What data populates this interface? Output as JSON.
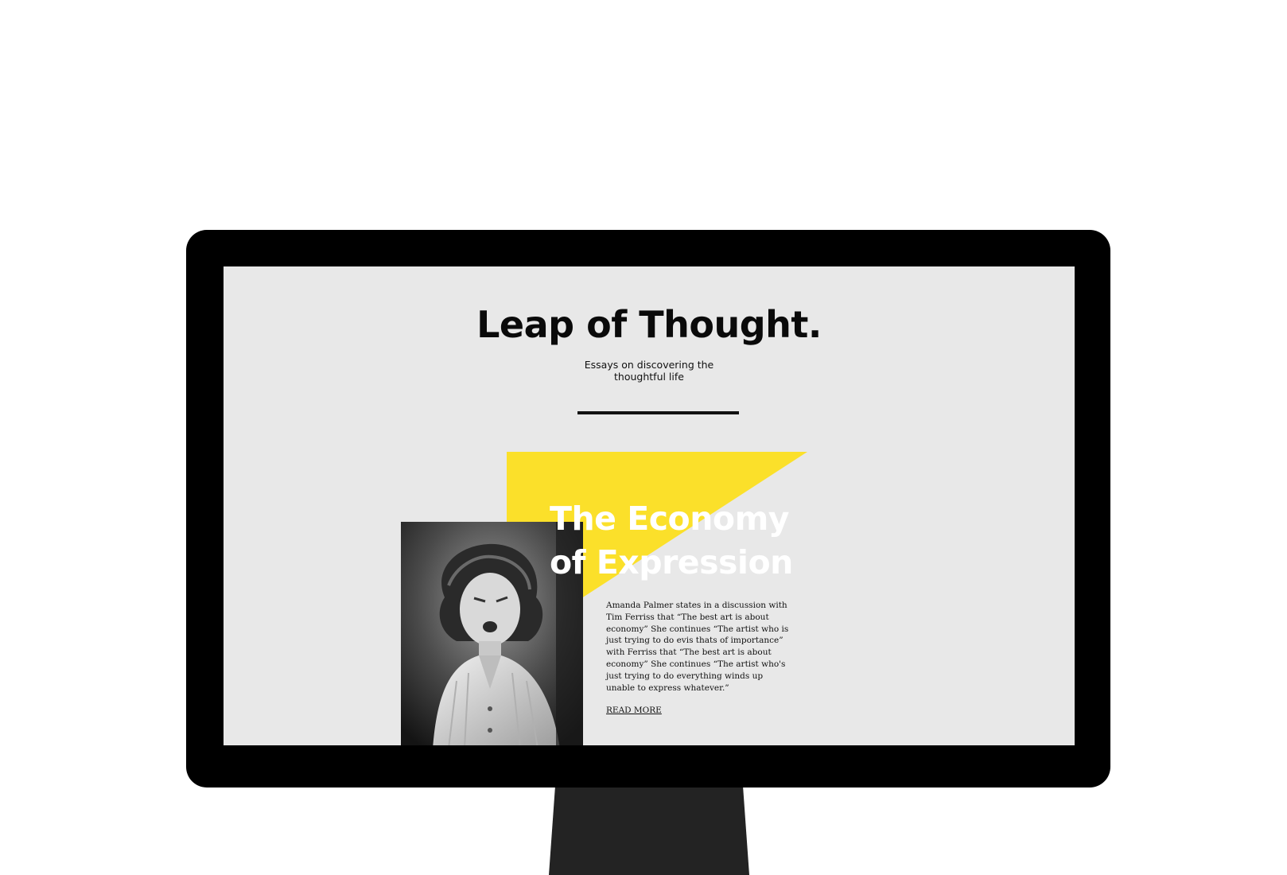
{
  "site": {
    "title": "Leap of Thought.",
    "tagline_lines": [
      "Essays on discovering the",
      "thoughtful life"
    ]
  },
  "feature": {
    "title_lines": [
      "The Economy",
      "of Expression"
    ],
    "excerpt_lines": [
      "Amanda Palmer states in a discussion with",
      "Tim Ferriss that “The best art is about",
      "economy” She continues “The artist who is",
      "just trying to do evis thats of importance”",
      "with Ferriss that “The best art is about",
      "economy” She continues “The artist who's",
      "just trying to do everything winds up",
      "unable to express whatever.”"
    ],
    "read_more_label": "READ MORE"
  },
  "colors": {
    "accent_yellow": "#fbe02a",
    "screen_background": "#e8e8e8",
    "bezel": "#000000"
  }
}
